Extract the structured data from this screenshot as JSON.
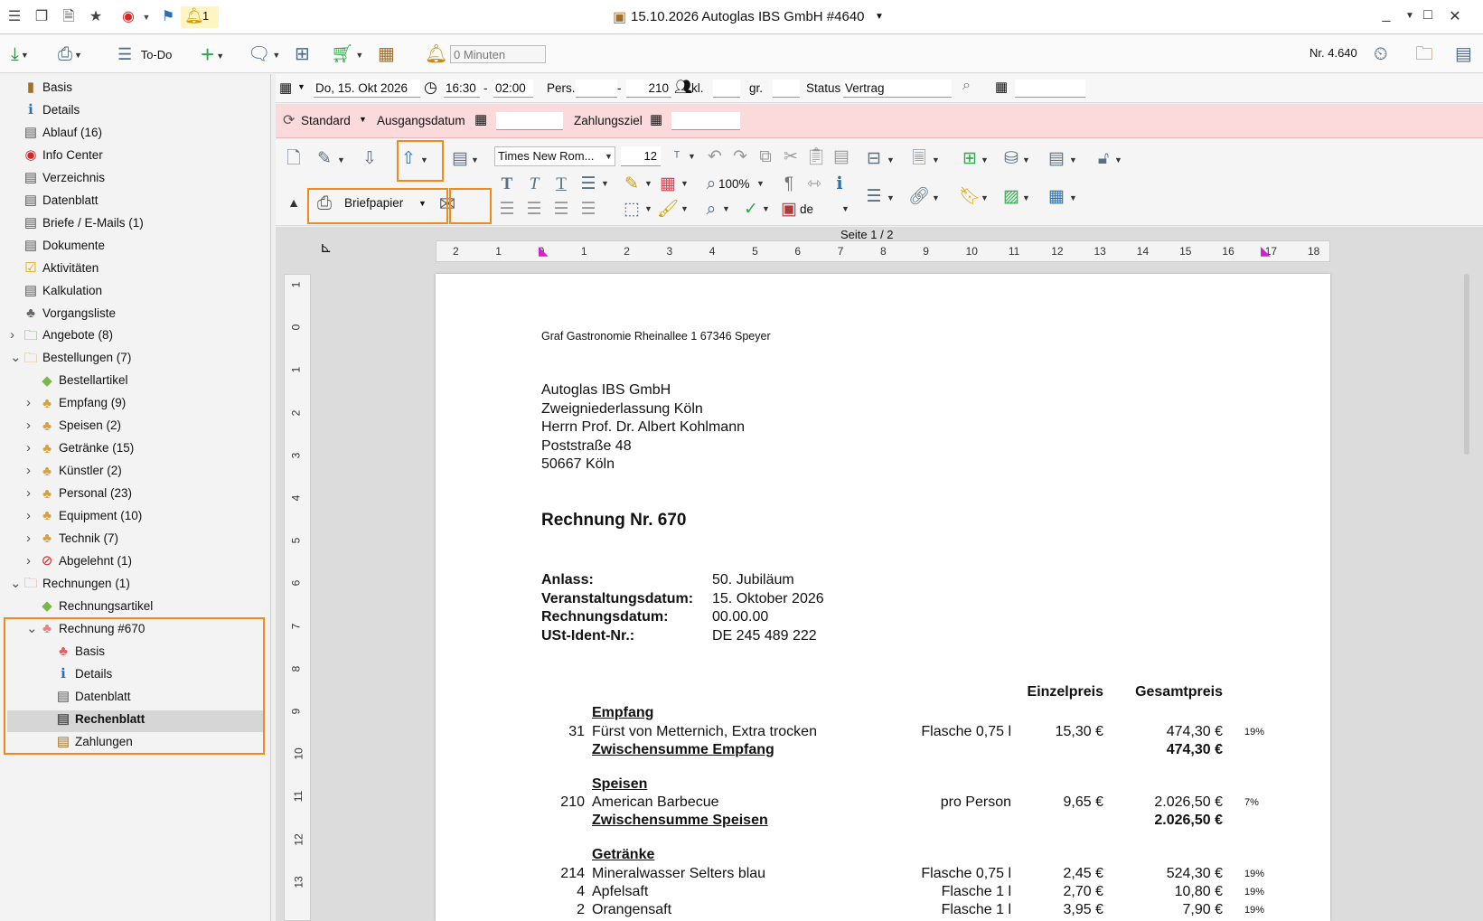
{
  "titlebar": {
    "title": "15.10.2026 Autoglas IBS GmbH  #4640",
    "badge_count": "1"
  },
  "toolbar": {
    "todo_label": "To-Do",
    "minutes_value": "0 Minuten",
    "nr_label": "Nr. 4.640"
  },
  "sidebar": {
    "items": [
      {
        "label": "Basis"
      },
      {
        "label": "Details"
      },
      {
        "label": "Ablauf (16)"
      },
      {
        "label": "Info Center"
      },
      {
        "label": "Verzeichnis"
      },
      {
        "label": "Datenblatt"
      },
      {
        "label": "Briefe / E-Mails (1)"
      },
      {
        "label": "Dokumente"
      },
      {
        "label": "Aktivitäten"
      },
      {
        "label": "Kalkulation"
      },
      {
        "label": "Vorgangsliste"
      },
      {
        "label": "Angebote (8)"
      },
      {
        "label": "Bestellungen (7)"
      },
      {
        "label": "Bestellartikel"
      },
      {
        "label": "Empfang (9)"
      },
      {
        "label": "Speisen (2)"
      },
      {
        "label": "Getränke (15)"
      },
      {
        "label": "Künstler (2)"
      },
      {
        "label": "Personal (23)"
      },
      {
        "label": "Equipment (10)"
      },
      {
        "label": "Technik (7)"
      },
      {
        "label": "Abgelehnt (1)"
      },
      {
        "label": "Rechnungen (1)"
      },
      {
        "label": "Rechnungsartikel"
      },
      {
        "label": "Rechnung #670"
      },
      {
        "label": "Basis"
      },
      {
        "label": "Details"
      },
      {
        "label": "Datenblatt"
      },
      {
        "label": "Rechenblatt"
      },
      {
        "label": "Zahlungen"
      }
    ]
  },
  "form": {
    "date": "Do, 15. Okt 2026",
    "time_from": "16:30",
    "time_sep": "-",
    "time_to": "02:00",
    "pers_label": "Pers.",
    "pers_from": "",
    "pers_sep": "-",
    "pers_to": "210",
    "kl_label": "kl.",
    "kl_value": "",
    "gr_label": "gr.",
    "gr_value": "",
    "status_label": "Status",
    "status_value": "Vertrag",
    "extra_date": "",
    "standard_label": "Standard",
    "ausgangsdatum_label": "Ausgangsdatum",
    "ausgangsdatum_value": "",
    "zahlungsziel_label": "Zahlungsziel",
    "zahlungsziel_value": ""
  },
  "ribbon": {
    "font_name": "Times New Rom...",
    "font_size": "12",
    "zoom": "100%",
    "language": "de",
    "briefpapier_label": "Briefpapier"
  },
  "document": {
    "page_indicator": "Seite 1 / 2",
    "ruler_top": [
      "2",
      "1",
      "0",
      "1",
      "2",
      "3",
      "4",
      "5",
      "6",
      "7",
      "8",
      "9",
      "10",
      "11",
      "12",
      "13",
      "14",
      "15",
      "16",
      "17",
      "18"
    ],
    "ruler_left": [
      "1",
      "0",
      "1",
      "2",
      "3",
      "4",
      "5",
      "6",
      "7",
      "8",
      "9",
      "10",
      "11",
      "12",
      "13"
    ],
    "sender": "Graf Gastronomie  Rheinallee 1  67346 Speyer",
    "address": [
      "Autoglas IBS GmbH",
      "Zweigniederlassung Köln",
      "Herrn Prof. Dr. Albert Kohlmann",
      "Poststraße 48",
      "50667 Köln"
    ],
    "heading": "Rechnung Nr. 670",
    "meta": [
      {
        "label": "Anlass:",
        "value": "50. Jubiläum"
      },
      {
        "label": "Veranstaltungsdatum:",
        "value": "15. Oktober 2026"
      },
      {
        "label": "Rechnungsdatum:",
        "value": "00.00.00"
      },
      {
        "label": "USt-Ident-Nr.:",
        "value": "DE 245 489 222"
      }
    ],
    "col_einzelpreis": "Einzelpreis",
    "col_gesamtpreis": "Gesamtpreis",
    "sections": [
      {
        "title": "Empfang",
        "rows": [
          {
            "qty": "31",
            "name": "Fürst von Metternich, Extra trocken",
            "unit": "Flasche 0,75 l",
            "price": "15,30 €",
            "total": "474,30 €",
            "tax": "19%"
          }
        ],
        "subtotal_label": "Zwischensumme Empfang",
        "subtotal": "474,30 €"
      },
      {
        "title": "Speisen",
        "rows": [
          {
            "qty": "210",
            "name": "American Barbecue",
            "unit": "pro Person",
            "price": "9,65 €",
            "total": "2.026,50 €",
            "tax": "7%"
          }
        ],
        "subtotal_label": "Zwischensumme Speisen",
        "subtotal": "2.026,50 €"
      },
      {
        "title": "Getränke",
        "rows": [
          {
            "qty": "214",
            "name": "Mineralwasser Selters blau",
            "unit": "Flasche 0,75 l",
            "price": "2,45 €",
            "total": "524,30 €",
            "tax": "19%"
          },
          {
            "qty": "4",
            "name": "Apfelsaft",
            "unit": "Flasche 1 l",
            "price": "2,70 €",
            "total": "10,80 €",
            "tax": "19%"
          },
          {
            "qty": "2",
            "name": "Orangensaft",
            "unit": "Flasche 1 l",
            "price": "3,95 €",
            "total": "7,90 €",
            "tax": "19%"
          }
        ]
      }
    ]
  },
  "colors": {
    "highlight": "#f28a1a",
    "pink_band": "#fadada",
    "selected_row": "#d6d6d6"
  }
}
